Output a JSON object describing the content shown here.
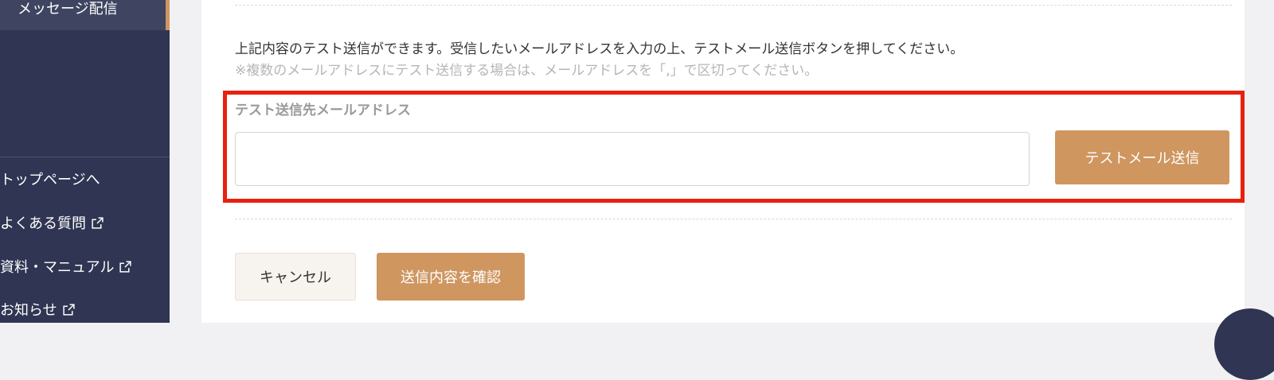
{
  "sidebar": {
    "active_item": "メッセージ配信",
    "links": [
      {
        "label": "トップページへ",
        "external": false
      },
      {
        "label": "よくある質問",
        "external": true
      },
      {
        "label": "資料・マニュアル",
        "external": true
      },
      {
        "label": "お知らせ",
        "external": true
      }
    ]
  },
  "main": {
    "description": "上記内容のテスト送信ができます。受信したいメールアドレスを入力の上、テストメール送信ボタンを押してください。",
    "note": "※複数のメールアドレスにテスト送信する場合は、メールアドレスを「,」で区切ってください。",
    "field_label": "テスト送信先メールアドレス",
    "email_value": "",
    "email_placeholder": "",
    "test_send_button": "テストメール送信",
    "cancel_button": "キャンセル",
    "confirm_button": "送信内容を確認"
  },
  "colors": {
    "sidebar_bg": "#2f3552",
    "accent": "#cf9660",
    "highlight_border": "#e8210f"
  },
  "icons": {
    "external_link": "external-link-icon"
  }
}
